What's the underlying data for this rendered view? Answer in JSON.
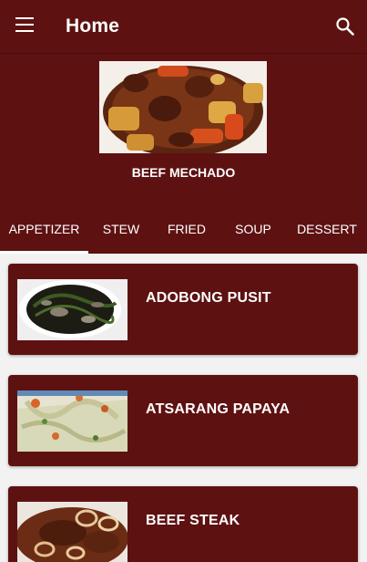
{
  "appbar": {
    "title": "Home",
    "menu_icon": "hamburger-menu-icon",
    "search_icon": "search-icon"
  },
  "featured": {
    "title": "BEEF MECHADO"
  },
  "tabs": [
    {
      "label": "APPETIZER",
      "selected": true
    },
    {
      "label": "STEW",
      "selected": false
    },
    {
      "label": "FRIED",
      "selected": false
    },
    {
      "label": "SOUP",
      "selected": false
    },
    {
      "label": "DESSERT",
      "selected": false
    }
  ],
  "recipes": [
    {
      "title": "ADOBONG PUSIT"
    },
    {
      "title": "ATSARANG PAPAYA"
    },
    {
      "title": "BEEF STEAK"
    }
  ],
  "colors": {
    "primary": "#5e1111",
    "on_primary": "#ffffff",
    "background": "#f2f2f2"
  }
}
